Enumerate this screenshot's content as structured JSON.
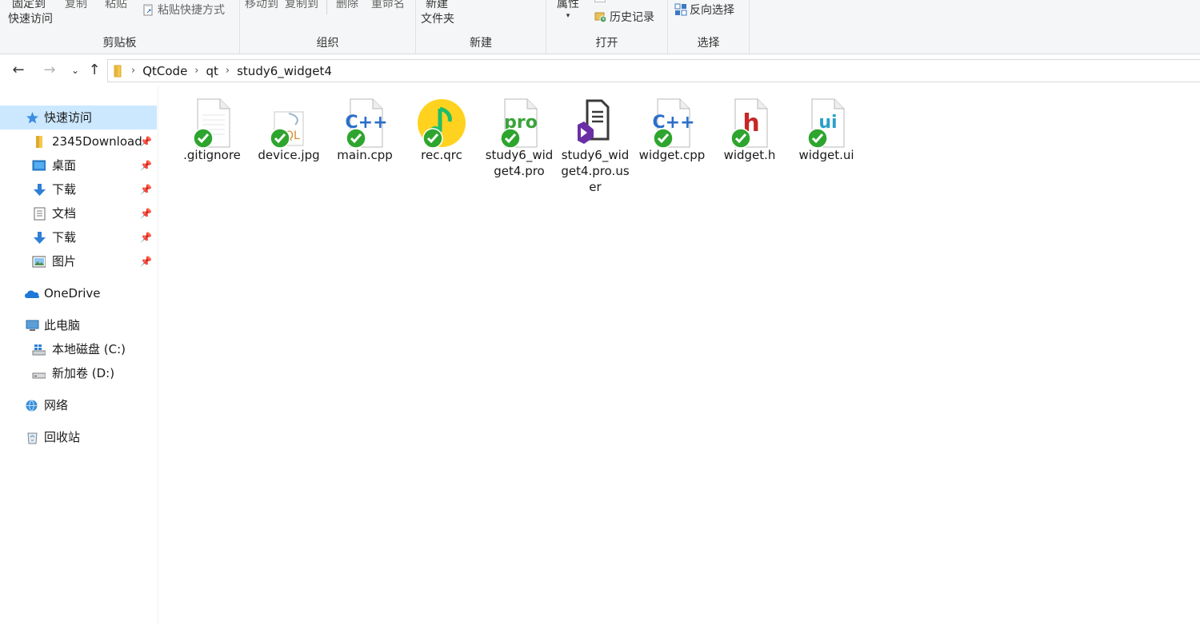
{
  "ribbon": {
    "clipboard": {
      "pin_quick_line1": "固定到",
      "pin_quick_line2": "快速访问",
      "copy": "复制",
      "paste": "粘贴",
      "paste_shortcut": "粘贴快捷方式",
      "group_label": "剪贴板"
    },
    "organize": {
      "move_to": "移动到",
      "copy_to": "复制到",
      "delete": "删除",
      "rename": "重命名",
      "group_label": "组织"
    },
    "new": {
      "new_folder_line1": "新建",
      "new_folder_line2": "文件夹",
      "group_label": "新建"
    },
    "open": {
      "properties": "属性",
      "history": "历史记录",
      "group_label": "打开"
    },
    "select": {
      "invert": "反向选择",
      "group_label": "选择"
    }
  },
  "address": {
    "crumbs": [
      "QtCode",
      "qt",
      "study6_widget4"
    ]
  },
  "sidebar": {
    "items": [
      {
        "label": "快速访问",
        "icon": "star-icon"
      },
      {
        "label": "2345Download",
        "icon": "folder-icon"
      },
      {
        "label": "桌面",
        "icon": "desktop-icon"
      },
      {
        "label": "下载",
        "icon": "download-icon"
      },
      {
        "label": "文档",
        "icon": "document-icon"
      },
      {
        "label": "下载",
        "icon": "download-icon"
      },
      {
        "label": "图片",
        "icon": "pictures-icon"
      },
      {
        "label": "OneDrive",
        "icon": "cloud-icon"
      },
      {
        "label": "此电脑",
        "icon": "computer-icon"
      },
      {
        "label": "本地磁盘 (C:)",
        "icon": "drive-c-icon"
      },
      {
        "label": "新加卷 (D:)",
        "icon": "drive-d-icon"
      },
      {
        "label": "网络",
        "icon": "network-icon"
      },
      {
        "label": "回收站",
        "icon": "recycle-bin-icon"
      }
    ]
  },
  "files": [
    {
      "name": ".gitignore",
      "icon": "blank-file-icon"
    },
    {
      "name": "device.jpg",
      "icon": "sql-file-icon",
      "badge": "SQL"
    },
    {
      "name": "main.cpp",
      "icon": "cpp-file-icon",
      "badge": "C++"
    },
    {
      "name": "rec.qrc",
      "icon": "qq-music-icon"
    },
    {
      "name": "study6_widget4.pro",
      "icon": "pro-file-icon",
      "badge": "pro"
    },
    {
      "name": "study6_widget4.pro.user",
      "icon": "visual-studio-file-icon"
    },
    {
      "name": "widget.cpp",
      "icon": "cpp-file-icon",
      "badge": "C++"
    },
    {
      "name": "widget.h",
      "icon": "header-file-icon",
      "badge": "h"
    },
    {
      "name": "widget.ui",
      "icon": "ui-file-icon",
      "badge": "ui"
    }
  ],
  "colors": {
    "selected": "#cce8ff",
    "check_green": "#2ea52e",
    "cpp_blue": "#2a6fc9",
    "pro_green": "#3aa33a",
    "header_red": "#c62828",
    "ui_teal": "#2aa0c9"
  }
}
